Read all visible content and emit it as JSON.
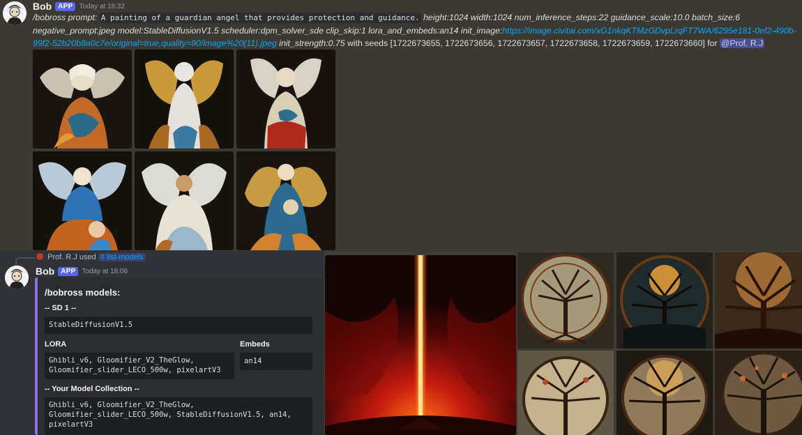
{
  "top_message": {
    "username": "Bob",
    "badge": "APP",
    "timestamp": "Today at 18:32",
    "command": "/bobross prompt:",
    "prompt_text": "A painting of a guardian angel that provides protection and guidance.",
    "params": "height:1024 width:1024 num_inference_steps:22 guidance_scale:10.0 batch_size:6 negative_prompt:jpeg model:StableDiffusionV1.5 scheduler:dpm_solver_sde clip_skip:1 lora_and_embeds:an14 init_image:",
    "init_image_url": "https://image.civitai.com/xG1nkqKTMzGDvpLrqFT7WA/6295e181-0ef2-490b-99f2-52b20b8a0c7e/original=true,quality=90/image%20(11).jpeg",
    "strength_label": "init_strength:0.75",
    "seeds_text": "with seeds [1722673655, 1722673656, 1722673657, 1722673658, 1722673659, 1722673660] for",
    "mention": "@Prof. R.J",
    "images": [
      {
        "name": "angel-image-1",
        "icon": "angel-painting"
      },
      {
        "name": "angel-image-2",
        "icon": "angel-painting"
      },
      {
        "name": "angel-image-3",
        "icon": "angel-painting"
      },
      {
        "name": "angel-image-4",
        "icon": "angel-painting"
      },
      {
        "name": "angel-image-5",
        "icon": "angel-painting"
      },
      {
        "name": "angel-image-6",
        "icon": "angel-painting"
      }
    ]
  },
  "bottom_message": {
    "reply_user": "Prof. R.J",
    "reply_verb": "used",
    "reply_command": "# list-models",
    "username": "Bob",
    "badge": "APP",
    "timestamp": "Today at 18:06",
    "embed": {
      "title": "/bobross models:",
      "sd_header": "-- SD 1 --",
      "sd_models": "StableDiffusionV1.5",
      "lora_header": "LORA",
      "lora_line1": "Ghibli_v6, Gloomifier_V2_TheGlow,",
      "lora_line2": "Gloomifier_slider_LECO_500w, pixelartV3",
      "embeds_header": "Embeds",
      "embeds_value": "an14",
      "collection_header": "-- Your Model Collection --",
      "collection_line1": "Ghibli_v6, Gloomifier_V2_TheGlow,",
      "collection_line2": "Gloomifier_slider_LECO_500w, StableDiffusionV1.5, an14,",
      "collection_line3": "pixelartV3"
    }
  },
  "colors": {
    "embed_accent": "#8e6fe8",
    "badge": "#5865f2",
    "link": "#00a8fc"
  }
}
